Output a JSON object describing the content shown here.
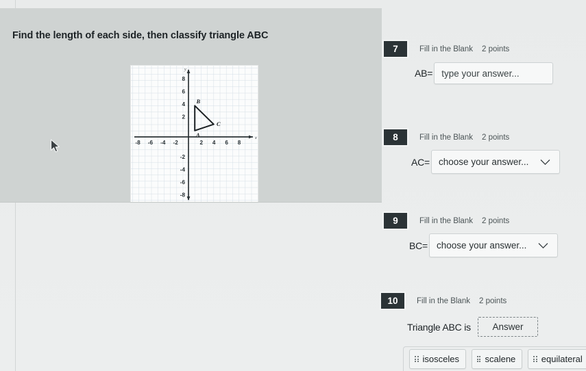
{
  "prompt": {
    "text": "Find the length of each side, then classify triangle ABC"
  },
  "figure": {
    "alt": "coordinate-plane-triangle",
    "axis_label_x": "x",
    "axis_label_y": "y",
    "x_ticks": [
      "-8",
      "-6",
      "-4",
      "-2",
      "2",
      "4",
      "6",
      "8"
    ],
    "y_ticks": [
      "8",
      "6",
      "4",
      "2",
      "-2",
      "-4",
      "-6",
      "-8"
    ],
    "points": [
      {
        "label": "A",
        "x": 1,
        "y": 1
      },
      {
        "label": "B",
        "x": 1,
        "y": 5
      },
      {
        "label": "C",
        "x": 4,
        "y": 2
      }
    ]
  },
  "questions": [
    {
      "number": "7",
      "type": "Fill in the Blank",
      "points": "2 points",
      "label": "AB=",
      "control": "text",
      "placeholder": "type your answer...",
      "value": ""
    },
    {
      "number": "8",
      "type": "Fill in the Blank",
      "points": "2 points",
      "label": "AC=",
      "control": "select",
      "selected": "choose your answer...",
      "icon": "chevron-down-icon"
    },
    {
      "number": "9",
      "type": "Fill in the Blank",
      "points": "2 points",
      "label": "BC=",
      "control": "select",
      "selected": "choose your answer...",
      "icon": "chevron-down-icon"
    },
    {
      "number": "10",
      "type": "Fill in the Blank",
      "points": "2 points",
      "label": "Triangle ABC is",
      "control": "dropzone",
      "dropzone_text": "Answer"
    }
  ],
  "answer_chips": [
    {
      "label": "isosceles"
    },
    {
      "label": "scalene"
    },
    {
      "label": "equilateral"
    }
  ],
  "colors": {
    "badge_bg": "#2b3336",
    "stem_panel": "#cfd3d2",
    "page_bg": "#eceeee",
    "text": "#1d2326"
  },
  "cursor": {
    "icon": "mouse-pointer-icon"
  }
}
